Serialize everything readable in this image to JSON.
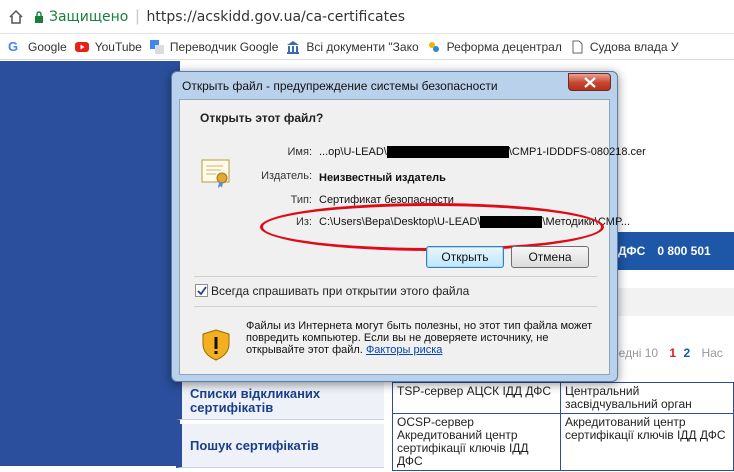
{
  "browser": {
    "secure_label": "Защищено",
    "separator": "|",
    "url": "https://acskidd.gov.ua/ca-certificates",
    "bookmarks": [
      {
        "label": "Google",
        "icon": "google-icon"
      },
      {
        "label": "YouTube",
        "icon": "youtube-icon"
      },
      {
        "label": "Переводчик Google",
        "icon": "translate-icon"
      },
      {
        "label": "Всі документи \"Зако",
        "icon": "law-icon"
      },
      {
        "label": "Реформа децентрал",
        "icon": "reform-icon"
      },
      {
        "label": "Судова влада У",
        "icon": "document-icon"
      }
    ]
  },
  "page": {
    "phone_label": "ДФС",
    "phone_number": "0 800 501",
    "pager_prefix": "редні 10",
    "pager_current": "1",
    "pager_next": "2",
    "pager_suffix": "Нас",
    "column_head": "ик",
    "side_menu": [
      "Списки відкликаних сертифікатів",
      "Пошук сертифікатів"
    ],
    "table_rows": [
      [
        "TSP-сервер АЦСК ІДД ДФС",
        "Центральний засвідчувальний орган"
      ],
      [
        "OCSP-сервер Акредитований центр сертифікації ключів ІДД ДФС",
        "Акредитований центр сертифікації ключів ІДД ДФС"
      ]
    ]
  },
  "dialog": {
    "title": "Открыть файл - предупреждение системы безопасности",
    "question": "Открыть этот файл?",
    "name_label": "Имя:",
    "name_prefix": "...op\\U-LEAD\\",
    "name_suffix": "\\CMP1-IDDDFS-080218.cer",
    "publisher_label": "Издатель:",
    "publisher_value": "Неизвестный издатель",
    "type_label": "Тип:",
    "type_value": "Сертификат безопасности",
    "from_label": "Из:",
    "from_prefix": "C:\\Users\\Вера\\Desktop\\U-LEAD\\",
    "from_suffix": "\\Методики\\CMP...",
    "open_button": "Открыть",
    "cancel_button": "Отмена",
    "always_ask_label": "Всегда спрашивать при открытии этого файла",
    "always_ask_checked": true,
    "warning_text": "Файлы из Интернета могут быть полезны, но этот тип файла может повредить компьютер. Если вы не доверяете источнику, не открывайте этот файл.",
    "risk_link": "Факторы риска",
    "annotation_color": "#e00b18"
  }
}
